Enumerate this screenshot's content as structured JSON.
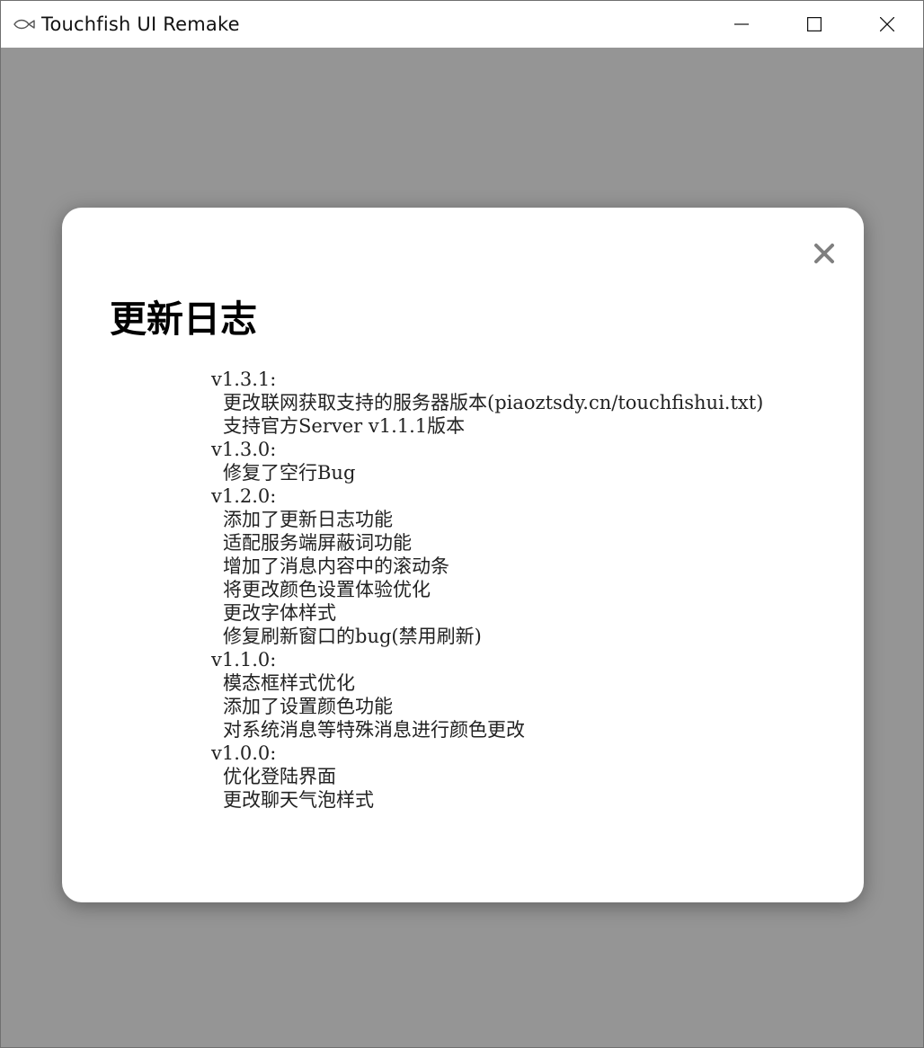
{
  "window": {
    "title": "Touchfish UI Remake",
    "app_icon": "fish-icon",
    "controls": [
      "minimize-icon",
      "maximize-icon",
      "close-icon"
    ]
  },
  "modal": {
    "title": "更新日志",
    "close_symbol": "✕",
    "changelog": [
      {
        "version": "v1.3.1:",
        "items": [
          "更改联网获取支持的服务器版本(piaoztsdy.cn/touchfishui.txt)",
          "支持官方Server v1.1.1版本"
        ]
      },
      {
        "version": "v1.3.0:",
        "items": [
          "修复了空行Bug"
        ]
      },
      {
        "version": "v1.2.0:",
        "items": [
          "添加了更新日志功能",
          "适配服务端屏蔽词功能",
          "增加了消息内容中的滚动条",
          "将更改颜色设置体验优化",
          "更改字体样式",
          "修复刷新窗口的bug(禁用刷新)"
        ]
      },
      {
        "version": "v1.1.0:",
        "items": [
          "模态框样式优化",
          "添加了设置颜色功能",
          "对系统消息等特殊消息进行颜色更改"
        ]
      },
      {
        "version": "v1.0.0:",
        "items": [
          "优化登陆界面",
          "更改聊天气泡样式"
        ]
      }
    ]
  },
  "colors": {
    "overlay": "#959595",
    "modal_bg": "#ffffff",
    "close_x": "#7f7f7f",
    "text": "#222222"
  }
}
